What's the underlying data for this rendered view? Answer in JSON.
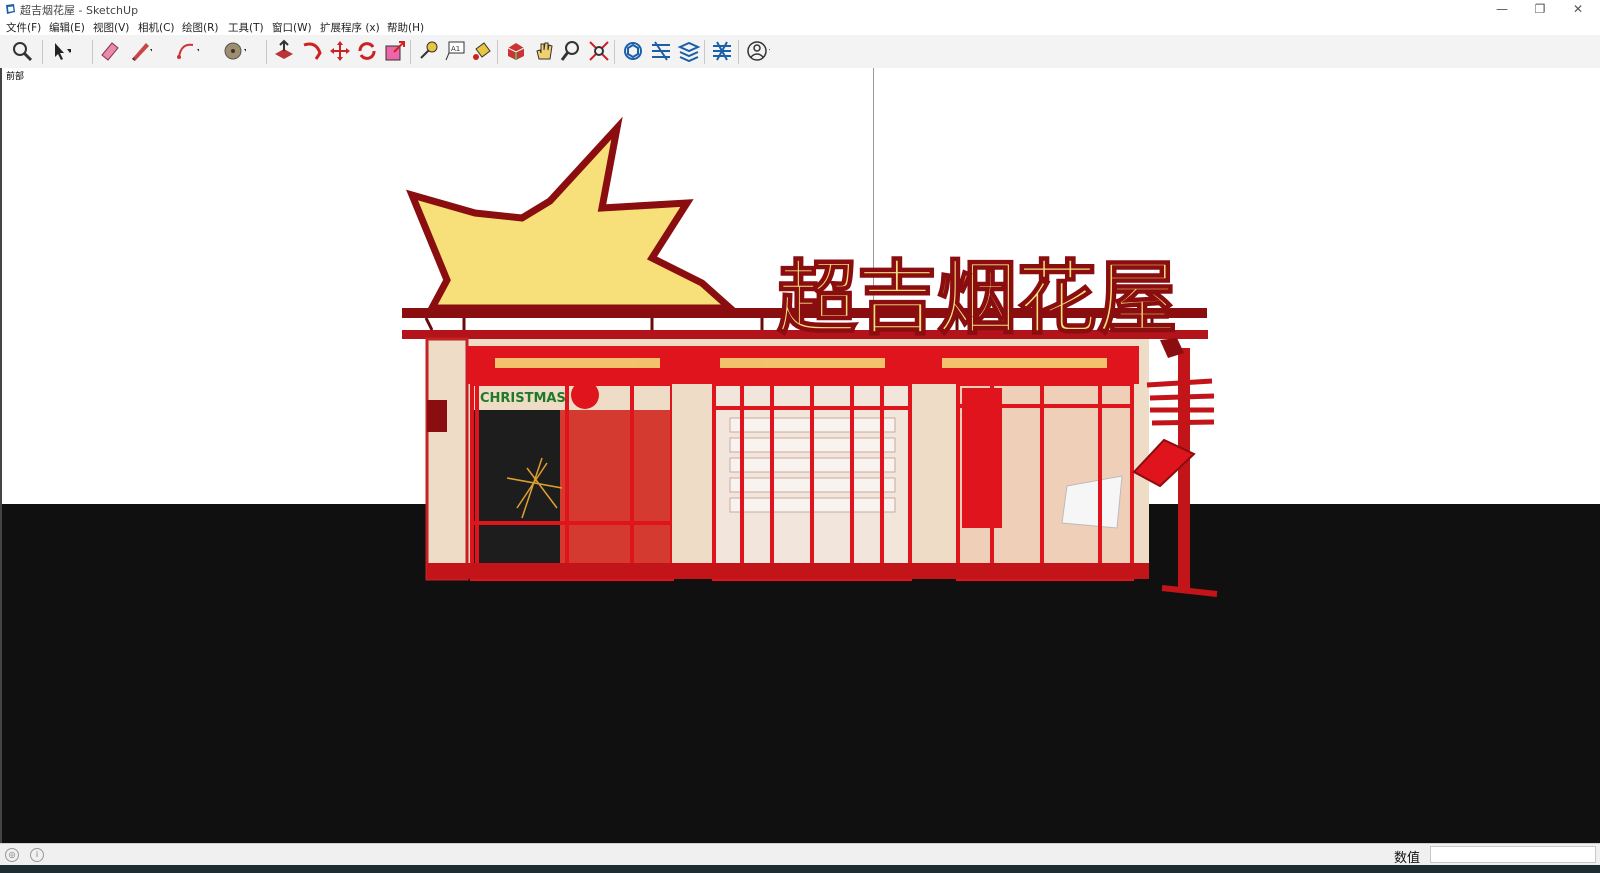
{
  "window": {
    "title": "超吉烟花屋 - SketchUp",
    "controls": [
      "—",
      "❐",
      "✕"
    ]
  },
  "menu": [
    "文件(F)",
    "编辑(E)",
    "视图(V)",
    "相机(C)",
    "绘图(R)",
    "工具(T)",
    "窗口(W)",
    "扩展程序 (x)",
    "帮助(H)"
  ],
  "toolbar": {
    "tools": [
      "zoom-icon",
      "select-icon",
      "eraser-icon",
      "pencil-line-icon",
      "arc-icon",
      "circle-icon",
      "push-pull-icon",
      "follow-me-icon",
      "move-icon",
      "rotate-icon",
      "scale-icon",
      "tape-measure-icon",
      "text-icon",
      "paint-bucket-icon",
      "orbit-icon",
      "pan-icon",
      "zoom-window-icon",
      "zoom-extents-icon",
      "warehouse-icon",
      "extension-icon",
      "layers-icon",
      "components-icon",
      "account-icon"
    ]
  },
  "viewport": {
    "scene_label": "前部"
  },
  "model": {
    "sign_text": "超吉烟花屋",
    "window_text": "CHRISTMAS"
  },
  "statusbar": {
    "measurements_label": "数值",
    "measurements_value": ""
  },
  "colors": {
    "ground": "#101010",
    "facade_red": "#e0141c",
    "sign_yellow": "#f7e07a",
    "dark_red": "#8a0d10",
    "wall_cream": "#efdcc6"
  }
}
